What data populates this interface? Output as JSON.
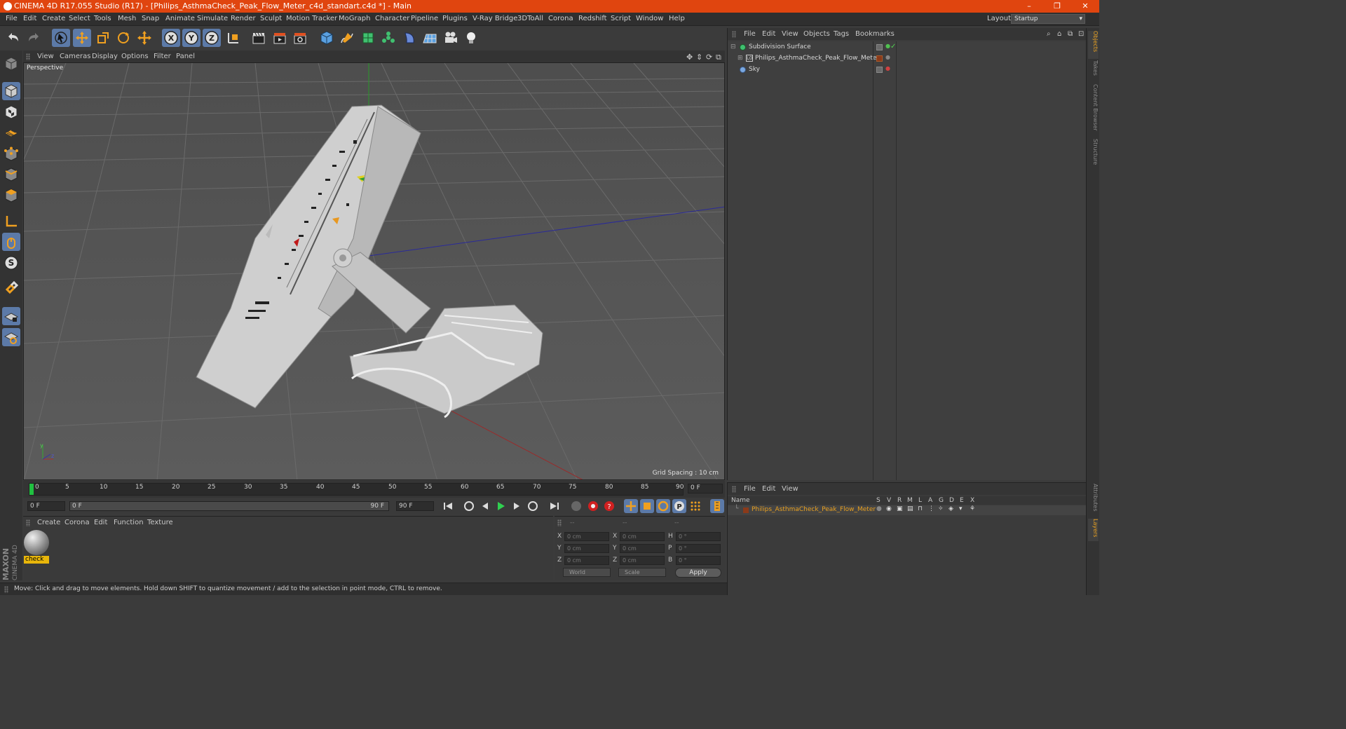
{
  "window": {
    "title": "CINEMA 4D R17.055 Studio (R17) - [Philips_AsthmaCheck_Peak_Flow_Meter_c4d_standart.c4d *] - Main",
    "minimize": "–",
    "maximize": "❐",
    "close": "✕"
  },
  "menu": [
    "File",
    "Edit",
    "Create",
    "Select",
    "Tools",
    "Mesh",
    "Snap",
    "Animate",
    "Simulate",
    "Render",
    "Sculpt",
    "Motion Tracker",
    "MoGraph",
    "Character",
    "Pipeline",
    "Plugins",
    "V-Ray Bridge",
    "3DToAll",
    "Corona",
    "Redshift",
    "Script",
    "Window",
    "Help"
  ],
  "layout": {
    "label": "Layout:",
    "value": "Startup"
  },
  "viewport": {
    "menu": [
      "View",
      "Cameras",
      "Display",
      "Options",
      "Filter",
      "Panel"
    ],
    "camera": "Perspective",
    "grid_spacing": "Grid Spacing : 10 cm"
  },
  "timeline": {
    "ticks": [
      "0",
      "5",
      "10",
      "15",
      "20",
      "25",
      "30",
      "35",
      "40",
      "45",
      "50",
      "55",
      "60",
      "65",
      "70",
      "75",
      "80",
      "85",
      "90"
    ],
    "current_frame": "0 F"
  },
  "transport": {
    "start": "0 F",
    "range_start": "0 F",
    "range_end": "90 F",
    "end": "90 F"
  },
  "material_panel": {
    "menu": [
      "Create",
      "Corona",
      "Edit",
      "Function",
      "Texture"
    ],
    "material_name": "check"
  },
  "coords": {
    "headers": [
      "--",
      "--",
      "--"
    ],
    "rows": [
      {
        "l1": "X",
        "v1": "0 cm",
        "l2": "X",
        "v2": "0 cm",
        "l3": "H",
        "v3": "0 °"
      },
      {
        "l1": "Y",
        "v1": "0 cm",
        "l2": "Y",
        "v2": "0 cm",
        "l3": "P",
        "v3": "0 °"
      },
      {
        "l1": "Z",
        "v1": "0 cm",
        "l2": "Z",
        "v2": "0 cm",
        "l3": "B",
        "v3": "0 °"
      }
    ],
    "world": "World",
    "scale": "Scale",
    "apply": "Apply"
  },
  "status": "Move: Click and drag to move elements. Hold down SHIFT to quantize movement / add to the selection in point mode, CTRL to remove.",
  "object_manager": {
    "menu": [
      "File",
      "Edit",
      "View",
      "Objects",
      "Tags",
      "Bookmarks"
    ],
    "objects": [
      {
        "name": "Subdivision Surface"
      },
      {
        "name": "Philips_AsthmaCheck_Peak_Flow_Meter"
      },
      {
        "name": "Sky"
      }
    ]
  },
  "layer_manager": {
    "menu": [
      "File",
      "Edit",
      "View"
    ],
    "headers": [
      "Name",
      "S",
      "V",
      "R",
      "M",
      "L",
      "A",
      "G",
      "D",
      "E",
      "X"
    ],
    "layer": "Philips_AsthmaCheck_Peak_Flow_Meter"
  },
  "right_tabs": [
    "Objects",
    "Takes",
    "Content Browser",
    "Structure",
    "Attributes",
    "Layers"
  ],
  "logo": {
    "brand": "MAXON",
    "product": "CINEMA 4D"
  },
  "colors": {
    "title_bar": "#e0450f",
    "selected_tool": "#5c7aa8",
    "material_label": "#e8b60a",
    "layer_name": "#e8a020"
  }
}
